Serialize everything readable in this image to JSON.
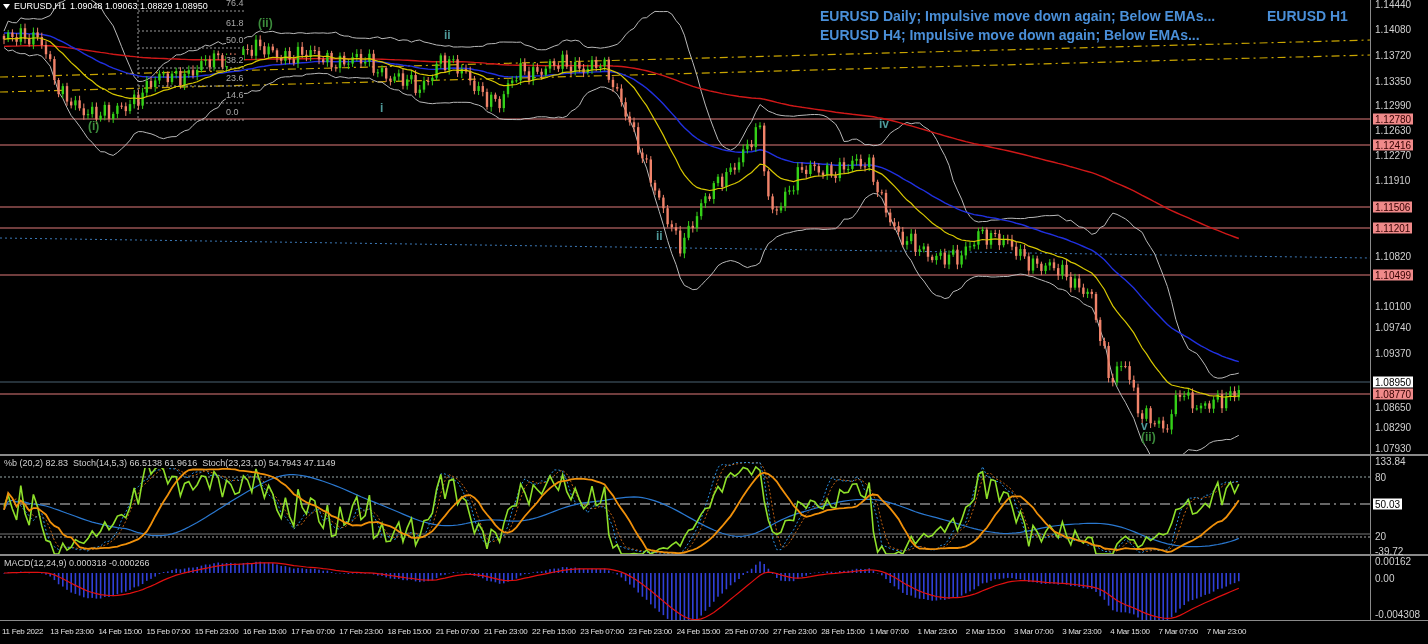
{
  "chart_header": {
    "symbol": "EURUSD,H1",
    "ohlc": "1.09048 1.09063 1.08829 1.08950"
  },
  "annotations": [
    {
      "text": "EURUSD Daily; Impulsive move down again; Below EMAs..."
    },
    {
      "text": "EURUSD H1"
    },
    {
      "text": "EURUSD H4; Impulsive move down again; Below EMAs..."
    }
  ],
  "fib_levels": [
    "76.4",
    "61.8",
    "50.0",
    "38.2",
    "23.6",
    "14.6",
    "0.0"
  ],
  "wave_labels": [
    {
      "text": "(i)",
      "color": "#3c8c3c"
    },
    {
      "text": "(ii)",
      "color": "#3c8c3c"
    },
    {
      "text": "i",
      "color": "#4f9a9a"
    },
    {
      "text": "ii",
      "color": "#4f9a9a"
    },
    {
      "text": "ii",
      "color": "#4f9a9a"
    },
    {
      "text": "iv",
      "color": "#4f9a9a"
    },
    {
      "text": "v",
      "color": "#4f9a9a"
    },
    {
      "text": "(ii)",
      "color": "#3c8c3c"
    }
  ],
  "price_axis": {
    "ticks": [
      "1.14440",
      "1.14080",
      "1.13720",
      "1.13350",
      "1.12990",
      "1.12630",
      "1.12270",
      "1.11910",
      "1.10820",
      "1.10100",
      "1.09740",
      "1.09370",
      "1.08650",
      "1.08290",
      "1.07930"
    ],
    "level_lines": [
      {
        "label": "1.12780",
        "kind": "level"
      },
      {
        "label": "1.12416",
        "kind": "level"
      },
      {
        "label": "1.11506",
        "kind": "level"
      },
      {
        "label": "1.11201",
        "kind": "level"
      },
      {
        "label": "1.10499",
        "kind": "level"
      },
      {
        "label": "1.08950",
        "kind": "bid"
      },
      {
        "label": "1.08770",
        "kind": "level"
      }
    ]
  },
  "oscillator": {
    "legend": "%b (20,2) 82.83  Stoch(14,5,3) 66.5138 61.9616  Stoch(23,23,10) 54.7943 47.1149",
    "axis": [
      "133.84",
      "80",
      "20",
      "-39.72"
    ],
    "marker": "50.03"
  },
  "macd": {
    "legend": "MACD(12,24,9) 0.000318 -0.000266",
    "axis": [
      "0.00162",
      "0.00",
      "-0.004308"
    ]
  },
  "time_axis": [
    "11 Feb 2022",
    "13 Feb 23:00",
    "14 Feb 15:00",
    "15 Feb 07:00",
    "15 Feb 23:00",
    "16 Feb 15:00",
    "17 Feb 07:00",
    "17 Feb 23:00",
    "18 Feb 15:00",
    "21 Feb 07:00",
    "21 Feb 23:00",
    "22 Feb 15:00",
    "23 Feb 07:00",
    "23 Feb 23:00",
    "24 Feb 15:00",
    "25 Feb 07:00",
    "27 Feb 23:00",
    "28 Feb 15:00",
    "1 Mar 07:00",
    "1 Mar 23:00",
    "2 Mar 15:00",
    "3 Mar 07:00",
    "3 Mar 23:00",
    "4 Mar 15:00",
    "7 Mar 07:00",
    "7 Mar 23:00"
  ]
}
